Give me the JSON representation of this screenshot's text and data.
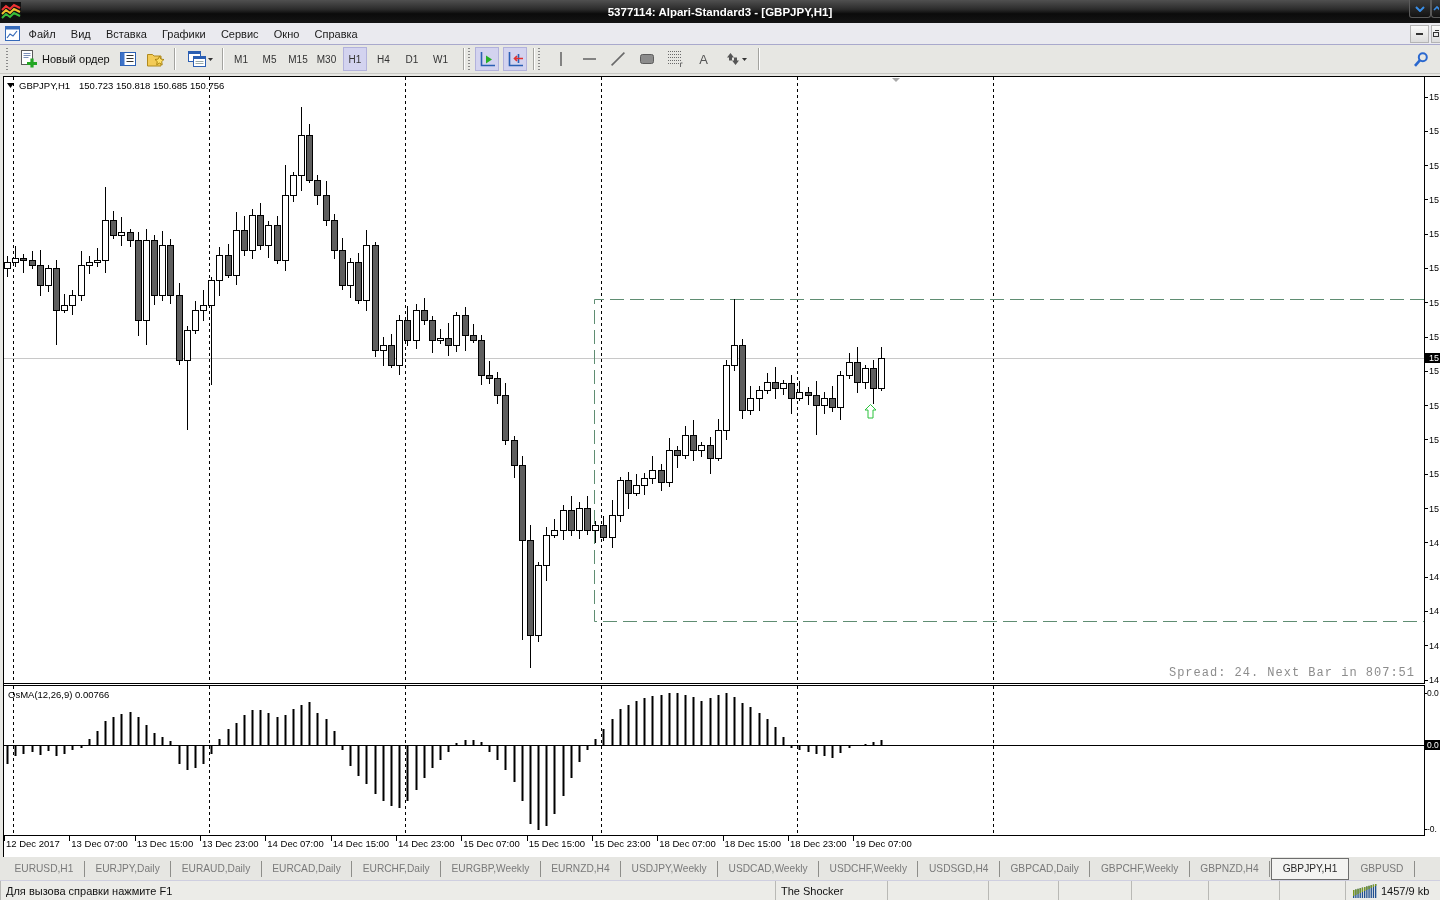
{
  "window": {
    "title": "5377114: Alpari-Standard3 - [GBPJPY,H1]"
  },
  "menu": [
    "Файл",
    "Вид",
    "Вставка",
    "Графики",
    "Сервис",
    "Окно",
    "Справка"
  ],
  "toolbar": {
    "new_order": "Новый ордер",
    "timeframes": [
      {
        "label": "M1",
        "selected": false
      },
      {
        "label": "M5",
        "selected": false
      },
      {
        "label": "M15",
        "selected": false
      },
      {
        "label": "M30",
        "selected": false
      },
      {
        "label": "H1",
        "selected": true
      },
      {
        "label": "H4",
        "selected": false
      },
      {
        "label": "D1",
        "selected": false
      },
      {
        "label": "W1",
        "selected": false
      }
    ],
    "toggles": [
      {
        "on": true
      },
      {
        "on": true
      }
    ],
    "text_tool": "A"
  },
  "chart": {
    "legend": {
      "symbol": "GBPJPY,H1",
      "values": "150.723 150.818 150.685 150.756"
    },
    "price_axis": [
      "15",
      "15",
      "15",
      "15",
      "15",
      "15",
      "15",
      "15",
      "15",
      "15",
      "15",
      "15",
      "15",
      "14",
      "14",
      "14",
      "14",
      "14"
    ],
    "price_marker": "15",
    "info": "Spread: 24. Next Bar in 807:51",
    "indicator": {
      "label": "OsMA(12,26,9) 0.00766",
      "axis": [
        "0.0",
        "-0."
      ],
      "marker": "0.0"
    },
    "time_axis": [
      "12 Dec 2017",
      "13 Dec 07:00",
      "13 Dec 15:00",
      "13 Dec 23:00",
      "14 Dec 07:00",
      "14 Dec 15:00",
      "14 Dec 23:00",
      "15 Dec 07:00",
      "15 Dec 15:00",
      "15 Dec 23:00",
      "18 Dec 07:00",
      "18 Dec 15:00",
      "18 Dec 23:00",
      "19 Dec 07:00"
    ]
  },
  "tabs": [
    {
      "label": "EURUSD,H1",
      "selected": false
    },
    {
      "label": "EURJPY,Daily",
      "selected": false
    },
    {
      "label": "EURAUD,Daily",
      "selected": false
    },
    {
      "label": "EURCAD,Daily",
      "selected": false
    },
    {
      "label": "EURCHF,Daily",
      "selected": false
    },
    {
      "label": "EURGBP,Weekly",
      "selected": false
    },
    {
      "label": "EURNZD,H4",
      "selected": false
    },
    {
      "label": "USDJPY,Weekly",
      "selected": false
    },
    {
      "label": "USDCAD,Weekly",
      "selected": false
    },
    {
      "label": "USDCHF,Weekly",
      "selected": false
    },
    {
      "label": "USDSGD,H4",
      "selected": false
    },
    {
      "label": "GBPCAD,Daily",
      "selected": false
    },
    {
      "label": "GBPCHF,Weekly",
      "selected": false
    },
    {
      "label": "GBPNZD,H4",
      "selected": false
    },
    {
      "label": "GBPJPY,H1",
      "selected": true
    },
    {
      "label": "GBPUSD",
      "selected": false
    }
  ],
  "status_bar": {
    "help": "Для вызова справки нажмите F1",
    "profile": "The Shocker",
    "traffic": "1457/9 kb"
  }
}
